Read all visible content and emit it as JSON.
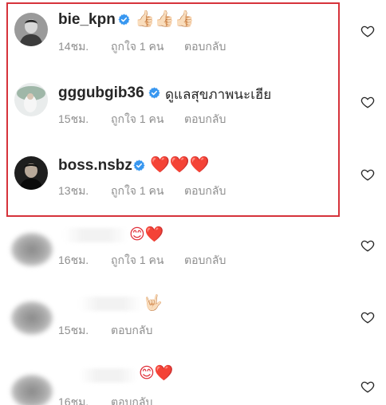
{
  "comments": [
    {
      "username": "bie_kpn",
      "verified": true,
      "text": "👍🏻👍🏻👍🏻",
      "time": "14ชม.",
      "likes": "ถูกใจ 1 คน",
      "reply": "ตอบกลับ"
    },
    {
      "username": "gggubgib36",
      "verified": true,
      "text": "ดูแลสุขภาพนะเฮีย",
      "time": "15ชม.",
      "likes": "ถูกใจ 1 คน",
      "reply": "ตอบกลับ"
    },
    {
      "username": "boss.nsbz",
      "verified": true,
      "text": "❤️❤️❤️",
      "time": "13ชม.",
      "likes": "ถูกใจ 1 คน",
      "reply": "ตอบกลับ"
    },
    {
      "username": "",
      "verified": false,
      "text": "😊❤️",
      "time": "16ชม.",
      "likes": "ถูกใจ 1 คน",
      "reply": "ตอบกลับ"
    },
    {
      "username": "",
      "verified": false,
      "text": "🤟🏻",
      "time": "15ชม.",
      "likes": "",
      "reply": "ตอบกลับ"
    },
    {
      "username": "",
      "verified": false,
      "text": "😊❤️",
      "time": "16ชม.",
      "likes": "",
      "reply": "ตอบกลับ"
    }
  ],
  "colors": {
    "highlight": "#d6333b",
    "verified": "#3897f0",
    "meta": "#8e8e8e",
    "text": "#262626"
  },
  "icons": {
    "like": "heart-outline-icon",
    "verified": "verified-badge-icon"
  }
}
